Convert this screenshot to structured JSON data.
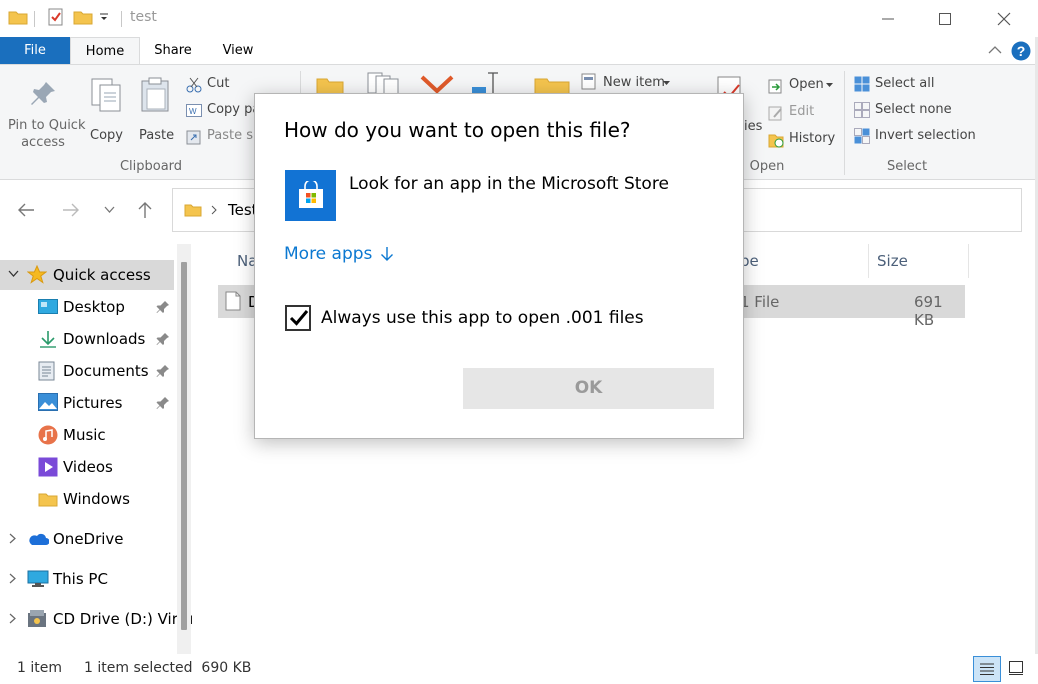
{
  "titlebar": {
    "title": "test"
  },
  "tabs": {
    "file": "File",
    "home": "Home",
    "share": "Share",
    "view": "View"
  },
  "ribbon": {
    "clipboard": {
      "pin_line1": "Pin to Quick",
      "pin_line2": "access",
      "copy": "Copy",
      "paste": "Paste",
      "cut": "Cut",
      "copy_path": "Copy pa",
      "paste_shortcut": "Paste sh",
      "group_label": "Clipboard"
    },
    "new": {
      "new_item": "New item"
    },
    "open": {
      "properties_fragment": "ies",
      "open": "Open",
      "edit": "Edit",
      "history": "History",
      "group_label": "Open"
    },
    "select": {
      "select_all": "Select all",
      "select_none": "Select none",
      "invert_selection": "Invert selection",
      "group_label": "Select"
    }
  },
  "address": {
    "current": "Test"
  },
  "nav": {
    "quick_access": "Quick access",
    "items": [
      {
        "label": "Desktop"
      },
      {
        "label": "Downloads"
      },
      {
        "label": "Documents"
      },
      {
        "label": "Pictures"
      },
      {
        "label": "Music"
      },
      {
        "label": "Videos"
      },
      {
        "label": "Windows"
      }
    ],
    "onedrive": "OneDrive",
    "this_pc": "This PC",
    "cd_drive": "CD Drive (D:) Virtu"
  },
  "content": {
    "col_name": "Na",
    "col_type": "pe",
    "col_size": "Size",
    "row": {
      "name_fragment": "D",
      "type_fragment": "1 File",
      "size": "691 KB"
    }
  },
  "dialog": {
    "title": "How do you want to open this file?",
    "store_option": "Look for an app in the Microsoft Store",
    "more_apps": "More apps",
    "always_use": "Always use this app to open .001 files",
    "always_use_checked": true,
    "ok": "OK"
  },
  "status": {
    "items": "1 item",
    "selected": "1 item selected  690 KB"
  },
  "colors": {
    "accent": "#1a6fbe",
    "link": "#0b78d1",
    "store_tile": "#1273d4",
    "selection": "#d9d9d9"
  }
}
